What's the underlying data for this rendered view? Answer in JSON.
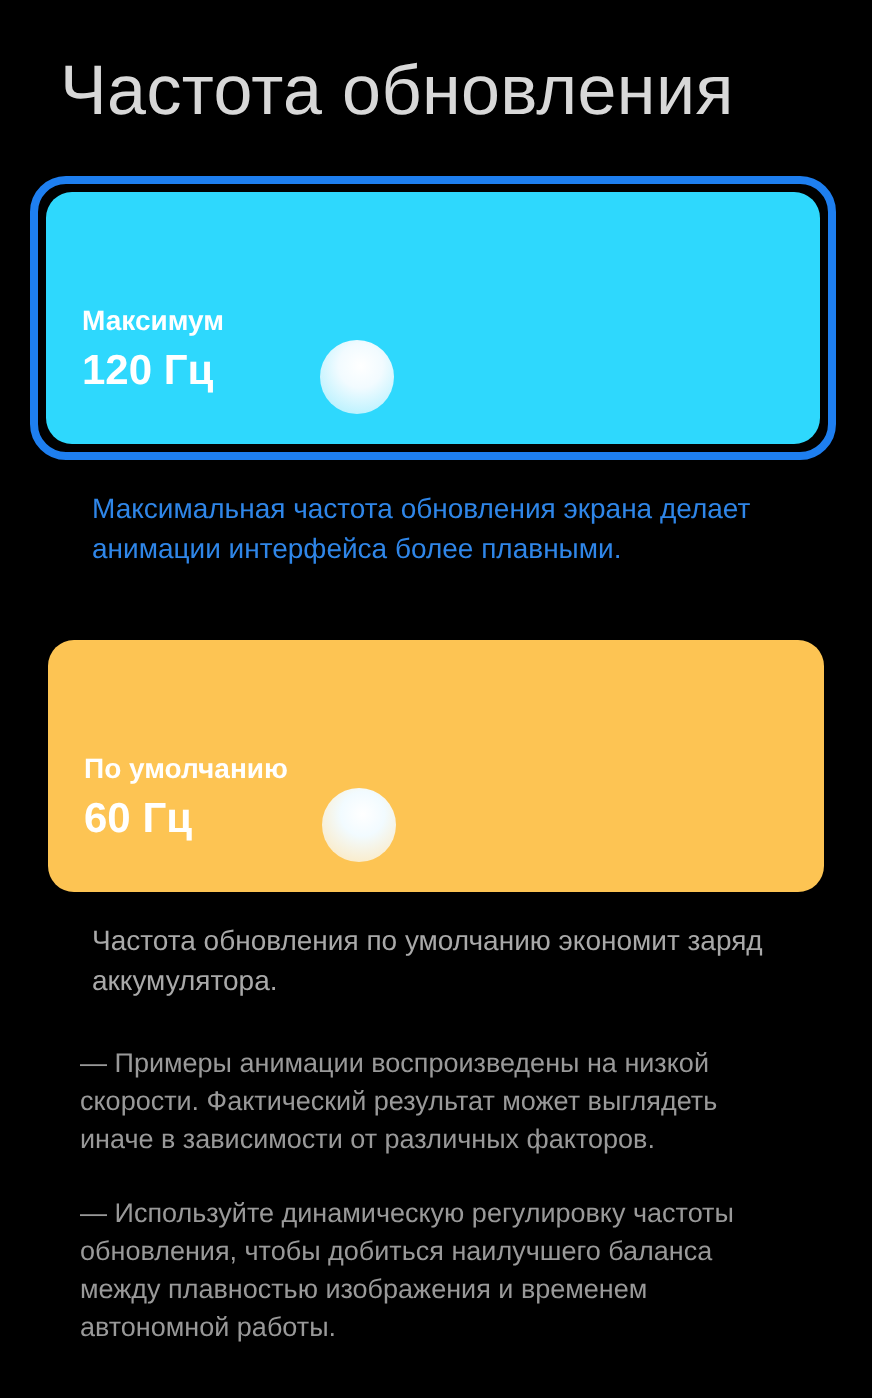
{
  "title": "Частота обновления",
  "options": [
    {
      "label": "Максимум",
      "value": "120 Гц",
      "color": "#2ed8fd",
      "selected": true,
      "description": "Максимальная частота обновления экрана делает анимации интерфейса более плавными."
    },
    {
      "label": "По умолчанию",
      "value": "60 Гц",
      "color": "#fdc453",
      "selected": false,
      "description": "Частота обновления по умолчанию экономит заряд аккумулятора."
    }
  ],
  "notes": [
    "— Примеры анимации воспроизведены на низкой скорости. Фактический результат может выглядеть иначе в зависимости от различных факторов.",
    "— Используйте динамическую регулировку частоты обновления, чтобы добиться наилучшего баланса между плавностью изображения и временем автономной работы."
  ]
}
